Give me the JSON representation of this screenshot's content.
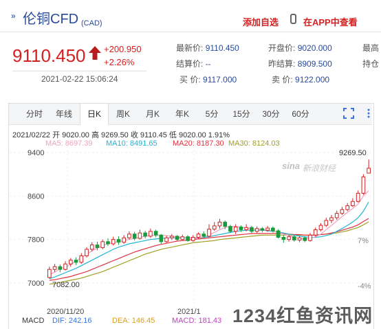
{
  "header": {
    "title": "伦铜CFD",
    "title_sub": "(CAD)",
    "add_favorite": "添加自选",
    "view_in_app": "在APP中查看"
  },
  "quote": {
    "price": "9110.450",
    "change": "+200.950",
    "change_pct": "+2.26%",
    "timestamp": "2021-02-22 15:06:24",
    "fields": [
      {
        "label": "最新价:",
        "value": "9110.450"
      },
      {
        "label": "开盘价:",
        "value": "9020.000"
      },
      {
        "label": "最高",
        "value": ""
      },
      {
        "label": "结算价:",
        "value": "--"
      },
      {
        "label": "昨结算:",
        "value": "8909.500"
      },
      {
        "label": "持仓",
        "value": ""
      },
      {
        "label": "买  价:",
        "value": "9117.000"
      },
      {
        "label": "卖  价:",
        "value": "9122.000"
      }
    ]
  },
  "tabs": [
    "分时",
    "年线",
    "日K",
    "周K",
    "月K",
    "年K",
    "5分",
    "15分",
    "30分",
    "60分"
  ],
  "active_tab": "日K",
  "info": {
    "line": "2021/02/22  开 9020.00  高 9269.50  收 9110.45  低 9020.00  1.91%",
    "ma5": "MA5: 8697.39",
    "ma10": "MA10: 8491.65",
    "ma20": "MA20: 8187.30",
    "ma30": "MA30: 8124.03"
  },
  "macd": {
    "label": "MACD",
    "dif": "DIF: 242.16",
    "dea": "DEA: 146.45",
    "macd": "MACD: 181.43"
  },
  "watermark": {
    "logo": "sina",
    "text": "新浪财经",
    "site": "1234红鱼资讯网"
  },
  "colors": {
    "up": "#d42020",
    "down": "#1a9a3a",
    "ma5": "#f2a0c0",
    "ma10": "#1fb3d6",
    "ma20": "#e03040",
    "ma30": "#a0a020"
  },
  "chart_data": {
    "type": "candlestick",
    "y_ticks": [
      "9400",
      "8600",
      "7800",
      "7000"
    ],
    "y_ticks_right": [
      "7%",
      "-4%"
    ],
    "x_ticks": [
      "2020/11/20",
      "2021/1"
    ],
    "ylim": [
      6800,
      9500
    ],
    "annotations": {
      "high": "9269.50",
      "low": "7082.00"
    },
    "candles": [
      {
        "o": 7100,
        "c": 7250,
        "h": 7300,
        "l": 7082
      },
      {
        "o": 7250,
        "c": 7300,
        "h": 7350,
        "l": 7200
      },
      {
        "o": 7300,
        "c": 7250,
        "h": 7340,
        "l": 7200
      },
      {
        "o": 7250,
        "c": 7350,
        "h": 7400,
        "l": 7230
      },
      {
        "o": 7350,
        "c": 7420,
        "h": 7460,
        "l": 7300
      },
      {
        "o": 7420,
        "c": 7380,
        "h": 7470,
        "l": 7330
      },
      {
        "o": 7380,
        "c": 7500,
        "h": 7550,
        "l": 7350
      },
      {
        "o": 7500,
        "c": 7620,
        "h": 7660,
        "l": 7470
      },
      {
        "o": 7620,
        "c": 7700,
        "h": 7750,
        "l": 7580
      },
      {
        "o": 7700,
        "c": 7650,
        "h": 7760,
        "l": 7600
      },
      {
        "o": 7650,
        "c": 7760,
        "h": 7800,
        "l": 7620
      },
      {
        "o": 7760,
        "c": 7720,
        "h": 7820,
        "l": 7680
      },
      {
        "o": 7720,
        "c": 7800,
        "h": 7850,
        "l": 7690
      },
      {
        "o": 7800,
        "c": 7750,
        "h": 7860,
        "l": 7700
      },
      {
        "o": 7750,
        "c": 7830,
        "h": 7880,
        "l": 7720
      },
      {
        "o": 7830,
        "c": 7900,
        "h": 7950,
        "l": 7800
      },
      {
        "o": 7900,
        "c": 7820,
        "h": 7940,
        "l": 7780
      },
      {
        "o": 7820,
        "c": 7920,
        "h": 7980,
        "l": 7800
      },
      {
        "o": 7920,
        "c": 7860,
        "h": 7960,
        "l": 7820
      },
      {
        "o": 7860,
        "c": 7950,
        "h": 8000,
        "l": 7830
      },
      {
        "o": 7950,
        "c": 7880,
        "h": 7980,
        "l": 7840
      },
      {
        "o": 7880,
        "c": 7760,
        "h": 7900,
        "l": 7720
      },
      {
        "o": 7760,
        "c": 7830,
        "h": 7870,
        "l": 7740
      },
      {
        "o": 7830,
        "c": 7860,
        "h": 7900,
        "l": 7790
      },
      {
        "o": 7860,
        "c": 7800,
        "h": 7880,
        "l": 7770
      },
      {
        "o": 7800,
        "c": 7850,
        "h": 7890,
        "l": 7780
      },
      {
        "o": 7850,
        "c": 7780,
        "h": 7880,
        "l": 7760
      },
      {
        "o": 7780,
        "c": 7840,
        "h": 7880,
        "l": 7760
      },
      {
        "o": 7840,
        "c": 7900,
        "h": 7930,
        "l": 7810
      },
      {
        "o": 7900,
        "c": 7860,
        "h": 7950,
        "l": 7830
      },
      {
        "o": 7860,
        "c": 7990,
        "h": 8080,
        "l": 7840
      },
      {
        "o": 7990,
        "c": 8050,
        "h": 8120,
        "l": 7960
      },
      {
        "o": 8050,
        "c": 8120,
        "h": 8180,
        "l": 8000
      },
      {
        "o": 8120,
        "c": 8040,
        "h": 8150,
        "l": 7990
      },
      {
        "o": 8040,
        "c": 7950,
        "h": 8070,
        "l": 7920
      },
      {
        "o": 7950,
        "c": 8030,
        "h": 8080,
        "l": 7900
      },
      {
        "o": 8030,
        "c": 7980,
        "h": 8060,
        "l": 7940
      },
      {
        "o": 7980,
        "c": 8020,
        "h": 8080,
        "l": 7950
      },
      {
        "o": 8020,
        "c": 7950,
        "h": 8050,
        "l": 7920
      },
      {
        "o": 7950,
        "c": 8000,
        "h": 8040,
        "l": 7920
      },
      {
        "o": 8000,
        "c": 7970,
        "h": 8030,
        "l": 7930
      },
      {
        "o": 7970,
        "c": 8010,
        "h": 8050,
        "l": 7940
      },
      {
        "o": 8010,
        "c": 7960,
        "h": 8040,
        "l": 7930
      },
      {
        "o": 7960,
        "c": 7840,
        "h": 7990,
        "l": 7820
      },
      {
        "o": 7840,
        "c": 7800,
        "h": 7880,
        "l": 7740
      },
      {
        "o": 7800,
        "c": 7850,
        "h": 7880,
        "l": 7760
      },
      {
        "o": 7850,
        "c": 7790,
        "h": 7880,
        "l": 7760
      },
      {
        "o": 7790,
        "c": 7830,
        "h": 7860,
        "l": 7750
      },
      {
        "o": 7830,
        "c": 7780,
        "h": 7860,
        "l": 7750
      },
      {
        "o": 7780,
        "c": 7880,
        "h": 7920,
        "l": 7760
      },
      {
        "o": 7880,
        "c": 7980,
        "h": 8020,
        "l": 7850
      },
      {
        "o": 7980,
        "c": 8060,
        "h": 8100,
        "l": 7950
      },
      {
        "o": 8060,
        "c": 8150,
        "h": 8200,
        "l": 8030
      },
      {
        "o": 8150,
        "c": 8200,
        "h": 8250,
        "l": 8100
      },
      {
        "o": 8200,
        "c": 8280,
        "h": 8330,
        "l": 8160
      },
      {
        "o": 8280,
        "c": 8350,
        "h": 8400,
        "l": 8250
      },
      {
        "o": 8350,
        "c": 8420,
        "h": 8470,
        "l": 8320
      },
      {
        "o": 8420,
        "c": 8500,
        "h": 8560,
        "l": 8400
      },
      {
        "o": 8500,
        "c": 8650,
        "h": 8700,
        "l": 8480
      },
      {
        "o": 8650,
        "c": 8950,
        "h": 9000,
        "l": 8620
      },
      {
        "o": 9020,
        "c": 9110,
        "h": 9269.5,
        "l": 9020
      }
    ],
    "ma5": [
      7150,
      7200,
      7260,
      7290,
      7340,
      7400,
      7470,
      7530,
      7590,
      7640,
      7690,
      7720,
      7740,
      7760,
      7780,
      7800,
      7820,
      7840,
      7860,
      7870,
      7880,
      7880,
      7870,
      7860,
      7850,
      7840,
      7830,
      7820,
      7830,
      7850,
      7880,
      7930,
      7980,
      8020,
      8040,
      8040,
      8030,
      8010,
      8000,
      7990,
      7980,
      7970,
      7960,
      7930,
      7900,
      7870,
      7840,
      7820,
      7810,
      7820,
      7850,
      7900,
      7980,
      8060,
      8140,
      8220,
      8300,
      8370,
      8450,
      8600,
      8697
    ],
    "ma10": [
      7080,
      7110,
      7150,
      7190,
      7230,
      7270,
      7320,
      7370,
      7420,
      7470,
      7520,
      7570,
      7620,
      7660,
      7690,
      7720,
      7740,
      7760,
      7780,
      7800,
      7810,
      7820,
      7830,
      7830,
      7830,
      7830,
      7830,
      7830,
      7830,
      7840,
      7850,
      7870,
      7890,
      7910,
      7930,
      7950,
      7960,
      7970,
      7970,
      7970,
      7970,
      7960,
      7950,
      7940,
      7920,
      7900,
      7880,
      7860,
      7850,
      7840,
      7840,
      7850,
      7870,
      7900,
      7950,
      8000,
      8060,
      8120,
      8200,
      8320,
      8491
    ],
    "ma20": [
      7050,
      7060,
      7080,
      7100,
      7120,
      7150,
      7180,
      7210,
      7250,
      7290,
      7330,
      7370,
      7410,
      7450,
      7490,
      7530,
      7570,
      7600,
      7630,
      7660,
      7690,
      7710,
      7730,
      7750,
      7770,
      7780,
      7790,
      7800,
      7810,
      7820,
      7830,
      7840,
      7850,
      7860,
      7870,
      7880,
      7890,
      7900,
      7910,
      7910,
      7910,
      7910,
      7910,
      7910,
      7910,
      7900,
      7890,
      7890,
      7880,
      7880,
      7880,
      7890,
      7900,
      7920,
      7940,
      7970,
      8000,
      8030,
      8070,
      8130,
      8187
    ],
    "ma30": [
      6980,
      6990,
      7010,
      7030,
      7050,
      7070,
      7090,
      7120,
      7150,
      7180,
      7210,
      7250,
      7290,
      7330,
      7370,
      7410,
      7450,
      7490,
      7530,
      7560,
      7590,
      7620,
      7640,
      7660,
      7680,
      7700,
      7720,
      7740,
      7750,
      7760,
      7770,
      7780,
      7800,
      7810,
      7820,
      7830,
      7840,
      7850,
      7860,
      7870,
      7880,
      7880,
      7880,
      7880,
      7880,
      7880,
      7880,
      7880,
      7880,
      7880,
      7880,
      7890,
      7900,
      7910,
      7920,
      7940,
      7960,
      7990,
      8020,
      8070,
      8124
    ]
  }
}
